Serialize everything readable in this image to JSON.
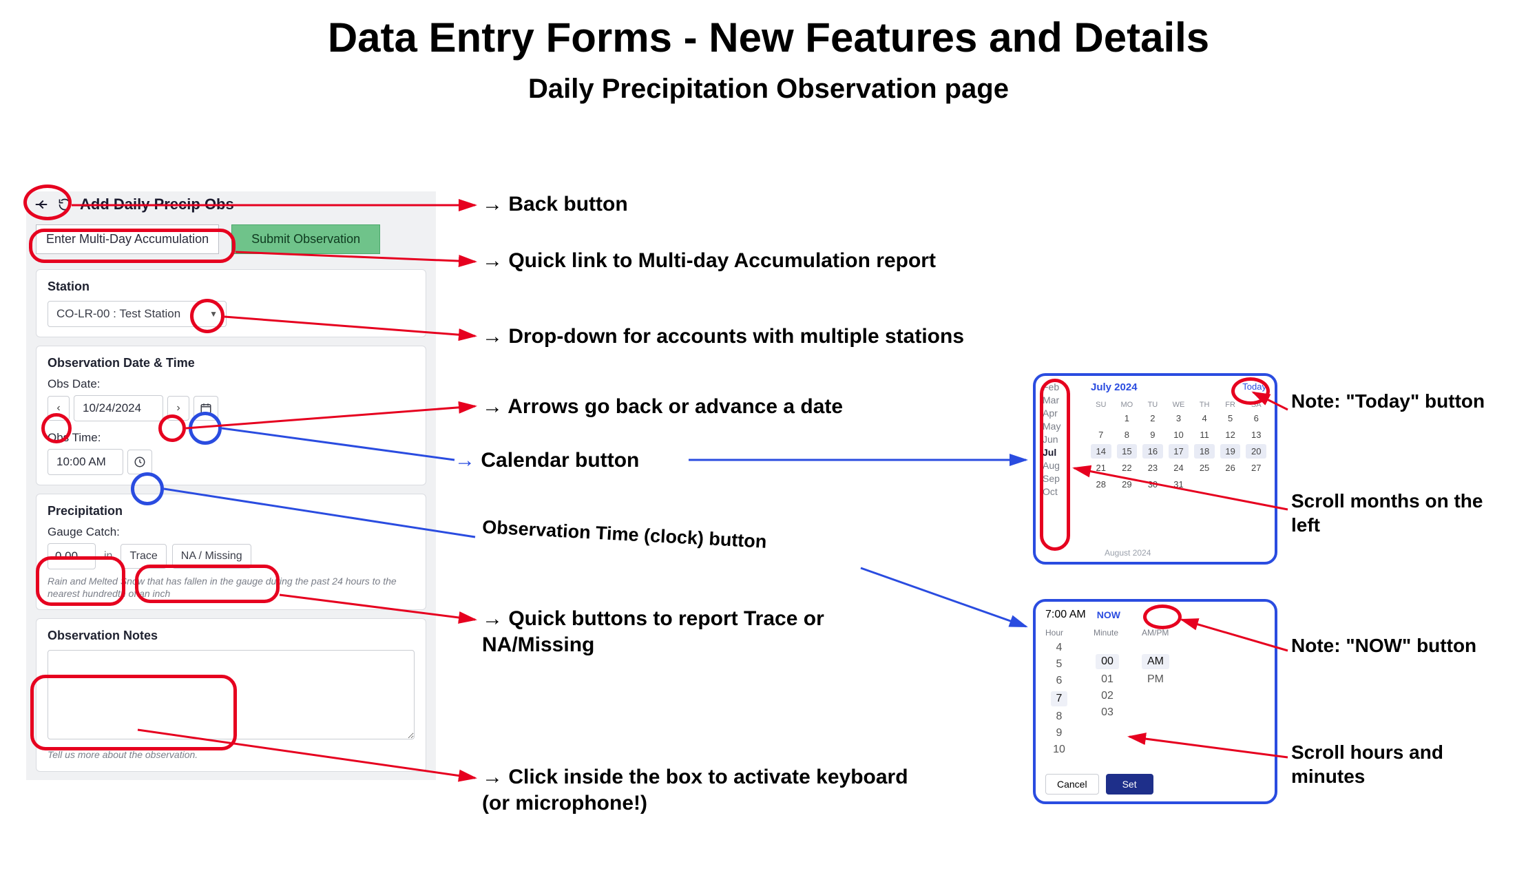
{
  "title": "Data Entry Forms - New Features and Details",
  "subtitle": "Daily Precipitation Observation page",
  "form": {
    "header": "Add Daily Precip Obs",
    "multi_day_btn": "Enter Multi-Day Accumulation",
    "submit_btn": "Submit Observation",
    "station_label": "Station",
    "station_value": "CO-LR-00 : Test Station",
    "obs_section": "Observation Date & Time",
    "obs_date_label": "Obs Date:",
    "obs_date_value": "10/24/2024",
    "obs_time_label": "Obs Time:",
    "obs_time_value": "10:00 AM",
    "precip_section": "Precipitation",
    "gauge_label": "Gauge Catch:",
    "gauge_value": "0.00",
    "gauge_unit": "in",
    "trace_btn": "Trace",
    "na_btn": "NA / Missing",
    "gauge_help": "Rain and Melted Snow that has fallen in the gauge during the past 24 hours to the nearest hundredth of an inch",
    "notes_section": "Observation Notes",
    "notes_help": "Tell us more about the observation."
  },
  "annotations": {
    "back": "Back button",
    "multi": "Quick link to Multi-day Accumulation report",
    "dropdown": "Drop-down for accounts with multiple stations",
    "arrows": "Arrows go back or advance a date",
    "calendar": "Calendar button",
    "clock": "Observation Time (clock) button",
    "quick": "Quick buttons to report Trace or NA/Missing",
    "notes": "Click inside the box to activate keyboard (or microphone!)"
  },
  "calendar": {
    "months": [
      "Feb",
      "Mar",
      "Apr",
      "May",
      "Jun",
      "Jul",
      "Aug",
      "Sep",
      "Oct"
    ],
    "selected_month": "Jul",
    "header_month": "July 2024",
    "today_label": "Today",
    "dow": [
      "SU",
      "MO",
      "TU",
      "WE",
      "TH",
      "FR",
      "SA"
    ],
    "weeks": [
      [
        "",
        "1",
        "2",
        "3",
        "4",
        "5",
        "6"
      ],
      [
        "7",
        "8",
        "9",
        "10",
        "11",
        "12",
        "13"
      ],
      [
        "14",
        "15",
        "16",
        "17",
        "18",
        "19",
        "20"
      ],
      [
        "21",
        "22",
        "23",
        "24",
        "25",
        "26",
        "27"
      ],
      [
        "28",
        "29",
        "30",
        "31",
        "",
        "",
        ""
      ]
    ],
    "highlight_row": 2,
    "footer": "August 2024"
  },
  "time_picker": {
    "display": "7:00 AM",
    "now_label": "NOW",
    "col_headers": [
      "Hour",
      "Minute",
      "AM/PM"
    ],
    "hours": [
      "4",
      "5",
      "6",
      "7",
      "8",
      "9",
      "10"
    ],
    "minutes": [
      "",
      "",
      "",
      "00",
      "01",
      "02",
      "03"
    ],
    "ampm": [
      "",
      "",
      "",
      "AM",
      "PM",
      "",
      ""
    ],
    "sel_index": 3,
    "cancel": "Cancel",
    "set": "Set"
  },
  "right_notes": {
    "today": "Note: \"Today\" button",
    "scroll_months": "Scroll months on the left",
    "now": "Note: \"NOW\" button",
    "scroll_hm": "Scroll hours and minutes"
  }
}
